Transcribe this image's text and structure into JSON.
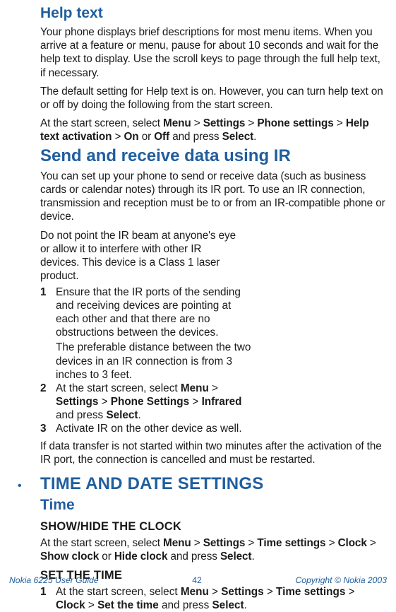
{
  "section1": {
    "title": "Help text",
    "p1_a": "Your phone displays brief descriptions for most menu items. When you arrive at a feature or menu, pause for about 10 seconds and wait for the help text to display. Use the scroll keys to page through the full help text, if necessary.",
    "p1_b": "The default setting for Help text is on. However, you can turn help text on or off by doing the following from the start screen.",
    "p1_c_pre": "At the start screen, select ",
    "p1_c_m1": "Menu",
    "p1_c_s1": " > ",
    "p1_c_m2": "Settings",
    "p1_c_s2": " > ",
    "p1_c_m3": "Phone settings",
    "p1_c_s3": " > ",
    "p1_c_m4": "Help text activation",
    "p1_c_s4": " > ",
    "p1_c_m5": "On",
    "p1_c_s5": " or ",
    "p1_c_m6": "Off",
    "p1_c_s6": " and press ",
    "p1_c_m7": "Select",
    "p1_c_end": "."
  },
  "section2": {
    "title": "Send and receive data using IR",
    "p2_a": "You can set up your phone to send or receive data (such as business cards or calendar notes) through its IR port. To use an IR connection, transmission and reception must be to or from an IR-compatible phone or device.",
    "p2_b": "Do not point the IR beam at anyone's eye or allow it to interfere with other IR devices. This device is a Class 1 laser product.",
    "li1_a": "Ensure that the IR ports of the sending and receiving devices are pointing at each other and that there are no obstructions between the devices.",
    "li1_b": "The preferable distance between the two devices in an IR connection is from 3 inches to 3 feet.",
    "li2_pre": "At the start screen, select ",
    "li2_m1": "Menu",
    "li2_s1": " > ",
    "li2_m2": "Settings",
    "li2_s2": " > ",
    "li2_m3": "Phone Settings",
    "li2_s3": " > ",
    "li2_m4": "Infrared",
    "li2_s4": " and press ",
    "li2_m5": "Select",
    "li2_end": ".",
    "li3": "Activate IR on the other device as well.",
    "p2_c": "If data transfer is not started within two minutes after the activation of the IR port, the connection is cancelled and must be restarted."
  },
  "section3": {
    "bullet": "•",
    "heading": "TIME AND DATE SETTINGS",
    "sub1": "Time",
    "h3a": "SHOW/HIDE THE CLOCK",
    "p3a_pre": "At the start screen, select ",
    "p3a_m1": "Menu",
    "p3a_s1": " > ",
    "p3a_m2": "Settings",
    "p3a_s2": " > ",
    "p3a_m3": "Time settings",
    "p3a_s3": " > ",
    "p3a_m4": "Clock",
    "p3a_s4": " > ",
    "p3a_m5": "Show clock",
    "p3a_s5": " or ",
    "p3a_m6": "Hide clock",
    "p3a_s6": " and press ",
    "p3a_m7": "Select",
    "p3a_end": ".",
    "h3b": "SET THE TIME",
    "li3b_pre": "At the start screen, select ",
    "li3b_m1": "Menu",
    "li3b_s1": " > ",
    "li3b_m2": "Settings",
    "li3b_s2": " > ",
    "li3b_m3": "Time settings",
    "li3b_s3": " > ",
    "li3b_m4": "Clock",
    "li3b_s4": " > ",
    "li3b_m5": "Set the time",
    "li3b_s5": " and press ",
    "li3b_m6": "Select",
    "li3b_end": "."
  },
  "nums": {
    "n1": "1",
    "n2": "2",
    "n3": "3"
  },
  "footer": {
    "left": "Nokia 6225 User Guide",
    "page": "42",
    "right": "Copyright © Nokia 2003"
  }
}
